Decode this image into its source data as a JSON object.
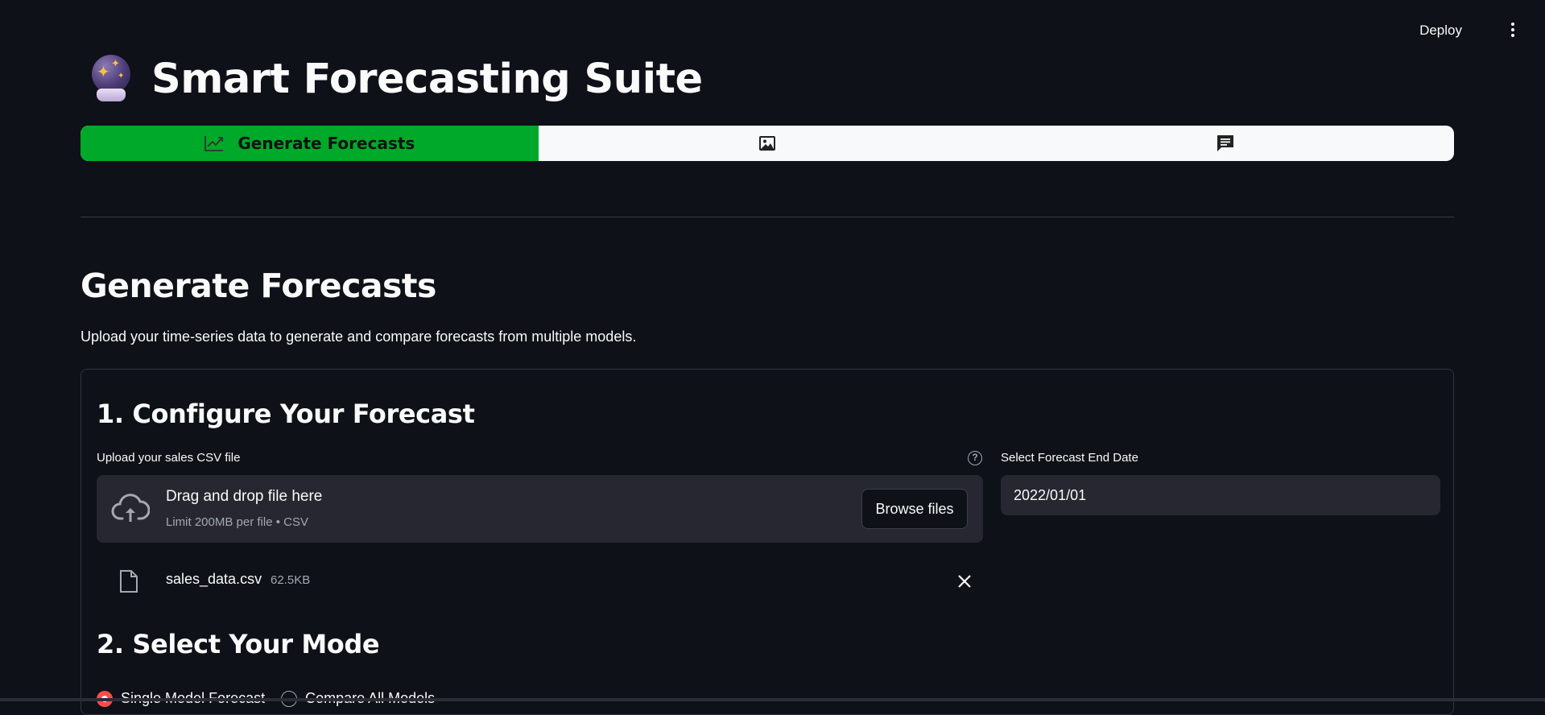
{
  "header": {
    "deploy_label": "Deploy",
    "menu_icon": "more-vert-icon"
  },
  "app": {
    "title": "Smart Forecasting Suite",
    "title_icon": "crystal-ball-icon"
  },
  "tabs": [
    {
      "label": "Generate Forecasts",
      "icon": "trending-up-icon",
      "active": true
    },
    {
      "label": "",
      "icon": "image-icon",
      "active": false
    },
    {
      "label": "",
      "icon": "chat-icon",
      "active": false
    }
  ],
  "colors": {
    "background": "#0e1117",
    "active_tab": "#00a929",
    "tab_bar": "#f8f9fa",
    "input_bg": "#262730",
    "radio_accent": "#ff4b4b"
  },
  "section": {
    "title": "Generate Forecasts",
    "subtitle": "Upload your time-series data to generate and compare forecasts from multiple models."
  },
  "configure": {
    "heading": "1. Configure Your Forecast",
    "upload_label": "Upload your sales CSV file",
    "dropzone_title": "Drag and drop file here",
    "dropzone_limit": "Limit 200MB per file • CSV",
    "browse_label": "Browse files",
    "uploaded_file": {
      "name": "sales_data.csv",
      "size": "62.5KB"
    },
    "date_label": "Select Forecast End Date",
    "date_value": "2022/01/01"
  },
  "mode": {
    "heading": "2. Select Your Mode",
    "options": [
      {
        "label": "Single Model Forecast",
        "selected": true
      },
      {
        "label": "Compare All Models",
        "selected": false
      }
    ]
  }
}
